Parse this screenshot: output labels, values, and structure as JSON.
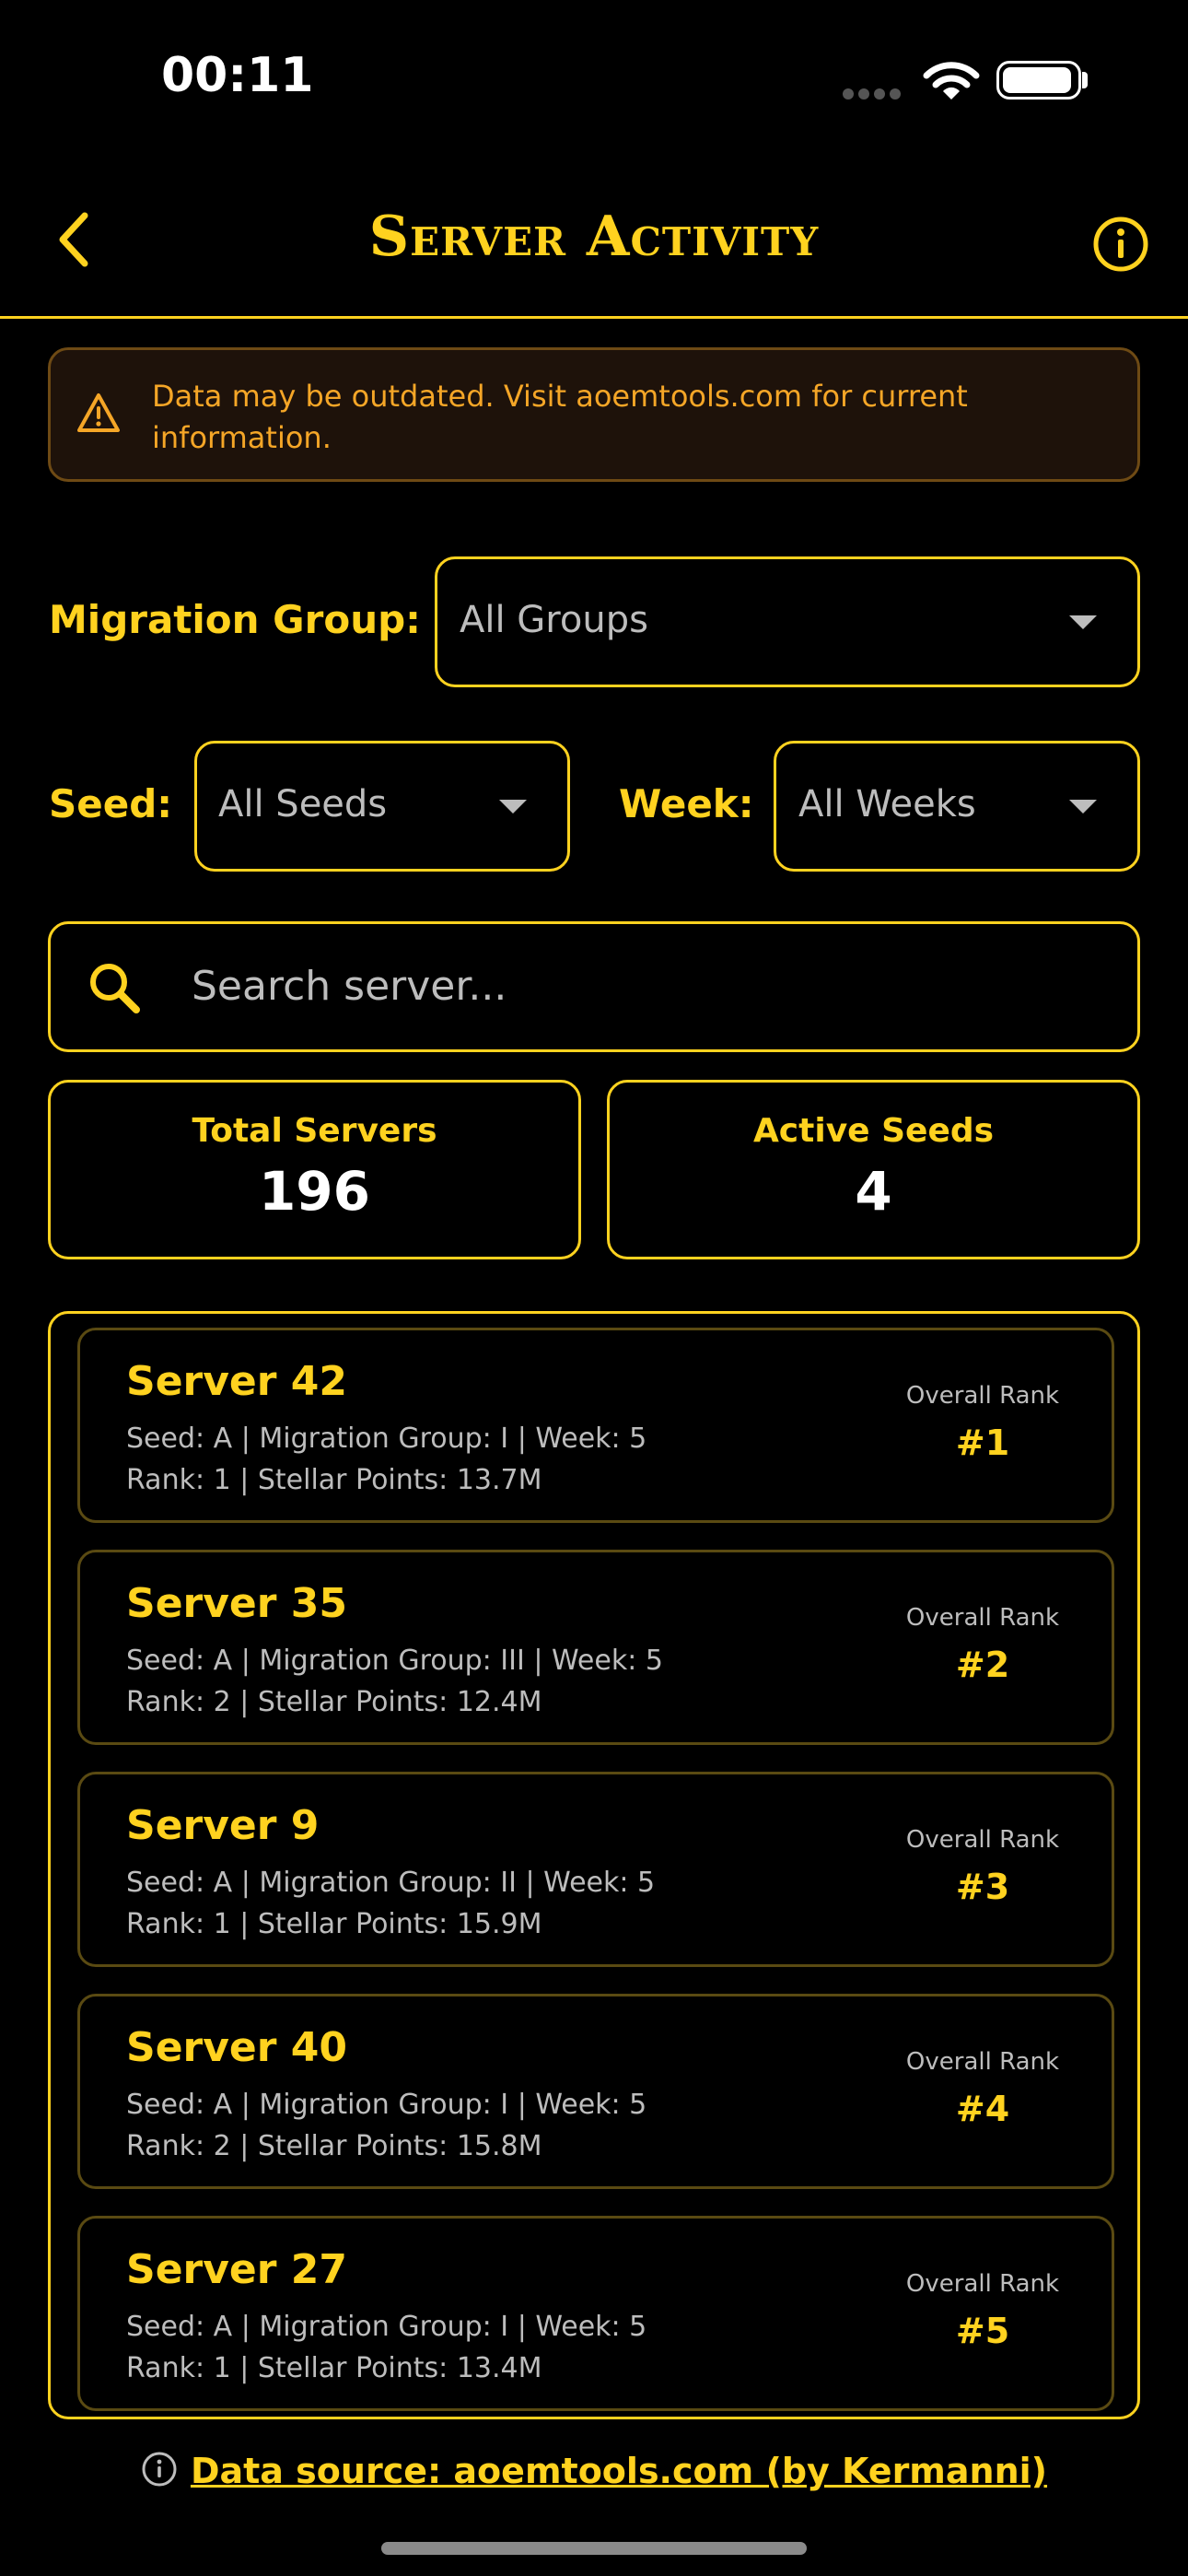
{
  "status": {
    "time": "00:11"
  },
  "header": {
    "title": "Server Activity"
  },
  "warning": {
    "text": "Data may be outdated. Visit aoemtools.com for current information."
  },
  "filters": {
    "migration_label": "Migration Group:",
    "migration_value": "All Groups",
    "seed_label": "Seed:",
    "seed_value": "All Seeds",
    "week_label": "Week:",
    "week_value": "All Weeks"
  },
  "search": {
    "placeholder": "Search server..."
  },
  "stats": {
    "total_label": "Total Servers",
    "total_value": "196",
    "seeds_label": "Active Seeds",
    "seeds_value": "4"
  },
  "servers": [
    {
      "name": "Server 42",
      "line1": "Seed: A | Migration Group: I | Week: 5",
      "line2": "Rank: 1 | Stellar Points: 13.7M",
      "rank_label": "Overall Rank",
      "rank": "#1"
    },
    {
      "name": "Server 35",
      "line1": "Seed: A | Migration Group: III | Week: 5",
      "line2": "Rank: 2 | Stellar Points: 12.4M",
      "rank_label": "Overall Rank",
      "rank": "#2"
    },
    {
      "name": "Server 9",
      "line1": "Seed: A | Migration Group: II | Week: 5",
      "line2": "Rank: 1 | Stellar Points: 15.9M",
      "rank_label": "Overall Rank",
      "rank": "#3"
    },
    {
      "name": "Server 40",
      "line1": "Seed: A | Migration Group: I | Week: 5",
      "line2": "Rank: 2 | Stellar Points: 15.8M",
      "rank_label": "Overall Rank",
      "rank": "#4"
    },
    {
      "name": "Server 27",
      "line1": "Seed: A | Migration Group: I | Week: 5",
      "line2": "Rank: 1 | Stellar Points: 13.4M",
      "rank_label": "Overall Rank",
      "rank": "#5"
    }
  ],
  "footer": {
    "source": "Data source: aoemtools.com (by Kermanni)"
  },
  "colors": {
    "accent": "#FFD21F",
    "warning": "#F5A627",
    "background": "#000000"
  }
}
